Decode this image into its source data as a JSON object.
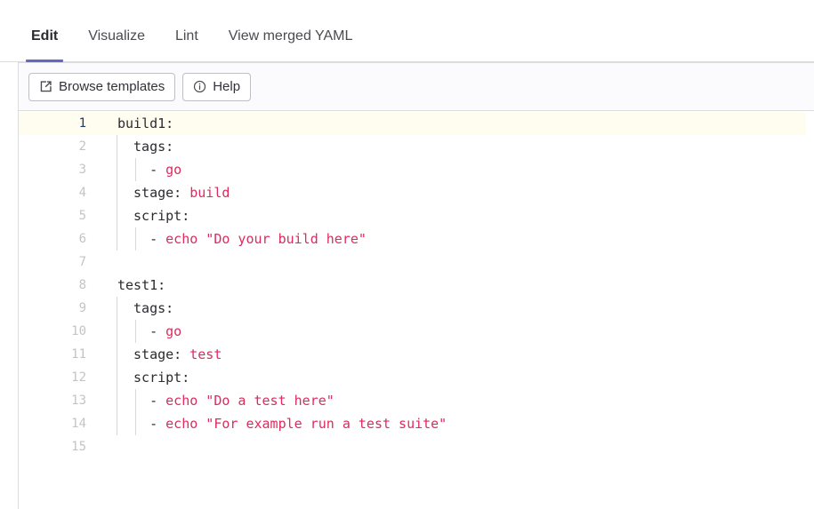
{
  "tabs": [
    {
      "label": "Edit",
      "active": true
    },
    {
      "label": "Visualize",
      "active": false
    },
    {
      "label": "Lint",
      "active": false
    },
    {
      "label": "View merged YAML",
      "active": false
    }
  ],
  "toolbar": {
    "browse_templates_label": "Browse templates",
    "browse_templates_icon": "external-link-icon",
    "help_label": "Help",
    "help_icon": "info-circle-icon"
  },
  "colors": {
    "active_tab_underline": "#6666c4",
    "yaml_value": "#dd2b5e",
    "yaml_key": "#2b2b30",
    "active_line_background": "#fffdf0",
    "active_line_number": "#1f3a68",
    "line_number": "#c4c4c7",
    "toolbar_background": "#fbfafd",
    "border": "#dcdcde"
  },
  "editor": {
    "language": "yaml",
    "active_line": 1,
    "total_lines": 15,
    "lines": [
      {
        "n": "1",
        "indent": 0,
        "guides": 0,
        "tokens": [
          {
            "t": "build1:",
            "c": "k"
          }
        ]
      },
      {
        "n": "2",
        "indent": 1,
        "guides": 1,
        "tokens": [
          {
            "t": "tags:",
            "c": "k"
          }
        ]
      },
      {
        "n": "3",
        "indent": 2,
        "guides": 2,
        "tokens": [
          {
            "t": "- ",
            "c": "d"
          },
          {
            "t": "go",
            "c": "v2"
          }
        ]
      },
      {
        "n": "4",
        "indent": 1,
        "guides": 1,
        "tokens": [
          {
            "t": "stage: ",
            "c": "k"
          },
          {
            "t": "build",
            "c": "v2"
          }
        ]
      },
      {
        "n": "5",
        "indent": 1,
        "guides": 1,
        "tokens": [
          {
            "t": "script:",
            "c": "k"
          }
        ]
      },
      {
        "n": "6",
        "indent": 2,
        "guides": 2,
        "tokens": [
          {
            "t": "- ",
            "c": "d"
          },
          {
            "t": "echo \"Do your build here\"",
            "c": "v2"
          }
        ]
      },
      {
        "n": "7",
        "indent": 0,
        "guides": 0,
        "tokens": []
      },
      {
        "n": "8",
        "indent": 0,
        "guides": 0,
        "tokens": [
          {
            "t": "test1:",
            "c": "k"
          }
        ]
      },
      {
        "n": "9",
        "indent": 1,
        "guides": 1,
        "tokens": [
          {
            "t": "tags:",
            "c": "k"
          }
        ]
      },
      {
        "n": "10",
        "indent": 2,
        "guides": 2,
        "tokens": [
          {
            "t": "- ",
            "c": "d"
          },
          {
            "t": "go",
            "c": "v2"
          }
        ]
      },
      {
        "n": "11",
        "indent": 1,
        "guides": 1,
        "tokens": [
          {
            "t": "stage: ",
            "c": "k"
          },
          {
            "t": "test",
            "c": "v2"
          }
        ]
      },
      {
        "n": "12",
        "indent": 1,
        "guides": 1,
        "tokens": [
          {
            "t": "script:",
            "c": "k"
          }
        ]
      },
      {
        "n": "13",
        "indent": 2,
        "guides": 2,
        "tokens": [
          {
            "t": "- ",
            "c": "d"
          },
          {
            "t": "echo \"Do a test here\"",
            "c": "v2"
          }
        ]
      },
      {
        "n": "14",
        "indent": 2,
        "guides": 2,
        "tokens": [
          {
            "t": "- ",
            "c": "d"
          },
          {
            "t": "echo \"For example run a test suite\"",
            "c": "v2"
          }
        ]
      },
      {
        "n": "15",
        "indent": 0,
        "guides": 0,
        "tokens": []
      }
    ]
  }
}
